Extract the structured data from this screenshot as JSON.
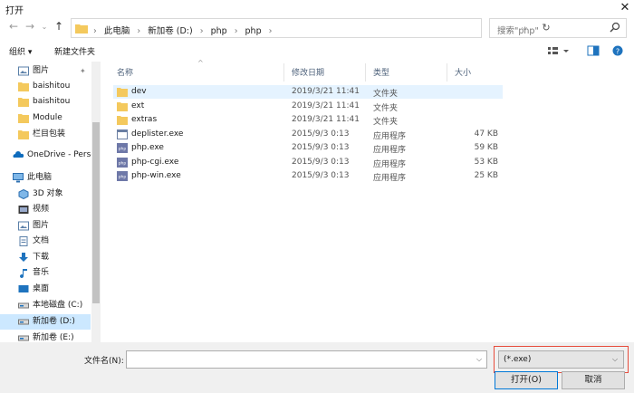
{
  "window": {
    "title": "打开"
  },
  "address": {
    "crumbs": [
      "此电脑",
      "新加卷 (D:)",
      "php",
      "php"
    ]
  },
  "search": {
    "placeholder": "搜索\"php\""
  },
  "toolbar": {
    "organize": "组织 ▾",
    "new_folder": "新建文件夹"
  },
  "nav": {
    "items": [
      {
        "label": "图片",
        "icon": "pictures-icon",
        "pinned": true
      },
      {
        "label": "baishitou",
        "icon": "folder-icon"
      },
      {
        "label": "baishitou",
        "icon": "folder-icon"
      },
      {
        "label": "Module",
        "icon": "folder-icon"
      },
      {
        "label": "栏目包装",
        "icon": "folder-icon"
      },
      {
        "label": "OneDrive - Personal",
        "icon": "onedrive-icon"
      },
      {
        "label": "此电脑",
        "icon": "pc-icon"
      },
      {
        "label": "3D 对象",
        "icon": "3d-objects-icon"
      },
      {
        "label": "视频",
        "icon": "video-icon"
      },
      {
        "label": "图片",
        "icon": "pictures-icon"
      },
      {
        "label": "文档",
        "icon": "documents-icon"
      },
      {
        "label": "下载",
        "icon": "download-icon"
      },
      {
        "label": "音乐",
        "icon": "music-icon"
      },
      {
        "label": "桌面",
        "icon": "desktop-icon"
      },
      {
        "label": "本地磁盘 (C:)",
        "icon": "drive-icon"
      },
      {
        "label": "新加卷 (D:)",
        "icon": "drive-icon",
        "selected": true
      },
      {
        "label": "新加卷 (E:)",
        "icon": "drive-icon"
      }
    ]
  },
  "columns": {
    "name": "名称",
    "date": "修改日期",
    "type": "类型",
    "size": "大小"
  },
  "files": [
    {
      "name": "dev",
      "date": "2019/3/21 11:41",
      "type": "文件夹",
      "size": "",
      "icon": "folder-icon",
      "selected": true
    },
    {
      "name": "ext",
      "date": "2019/3/21 11:41",
      "type": "文件夹",
      "size": "",
      "icon": "folder-icon"
    },
    {
      "name": "extras",
      "date": "2019/3/21 11:41",
      "type": "文件夹",
      "size": "",
      "icon": "folder-icon"
    },
    {
      "name": "deplister.exe",
      "date": "2015/9/3 0:13",
      "type": "应用程序",
      "size": "47 KB",
      "icon": "exe-icon"
    },
    {
      "name": "php.exe",
      "date": "2015/9/3 0:13",
      "type": "应用程序",
      "size": "59 KB",
      "icon": "php-exe-icon"
    },
    {
      "name": "php-cgi.exe",
      "date": "2015/9/3 0:13",
      "type": "应用程序",
      "size": "53 KB",
      "icon": "php-exe-icon"
    },
    {
      "name": "php-win.exe",
      "date": "2015/9/3 0:13",
      "type": "应用程序",
      "size": "25 KB",
      "icon": "php-exe-icon"
    }
  ],
  "bottom": {
    "filename_label": "文件名(N):",
    "filename_value": "",
    "filter": "(*.exe)",
    "open": "打开(O)",
    "cancel": "取消"
  },
  "colors": {
    "folder": "#f4c95d",
    "selection": "#cce8ff",
    "row_selection": "#e5f3ff",
    "highlight_border": "#e74c3c"
  }
}
